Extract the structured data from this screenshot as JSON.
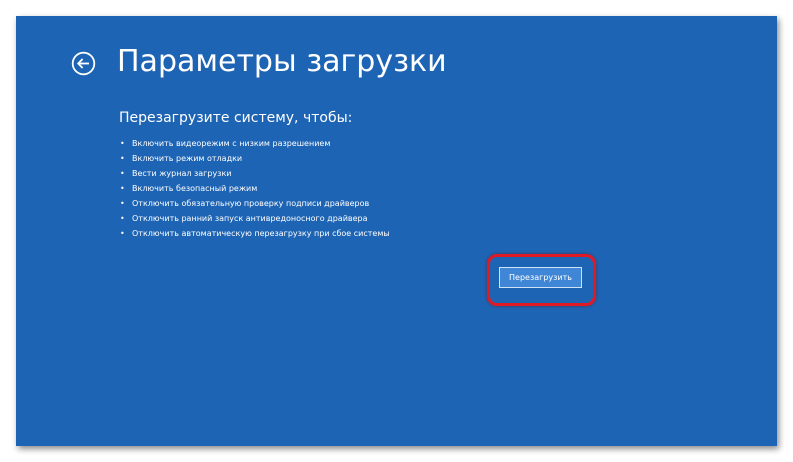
{
  "screen": {
    "background_color": "#1e64b4",
    "back_icon": "arrow-left-circle-icon",
    "title": "Параметры загрузки",
    "subtitle": "Перезагрузите систему, чтобы:",
    "bullet": "•",
    "options": [
      "Включить видеорежим с низким разрешением",
      "Включить режим отладки",
      "Вести журнал загрузки",
      "Включить безопасный режим",
      "Отключить обязательную проверку подписи драйверов",
      "Отключить ранний запуск антивредоносного драйвера",
      "Отключить автоматическую перезагрузку при сбое системы"
    ],
    "restart_button_label": "Перезагрузить",
    "highlight_color": "#e01a24"
  }
}
